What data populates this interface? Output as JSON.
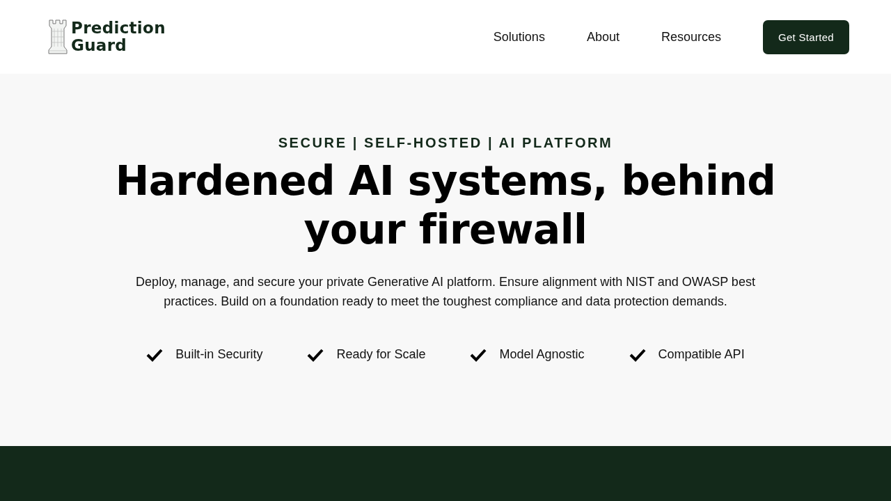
{
  "header": {
    "logo": {
      "line_1": "Prediction",
      "line_2": "Guard"
    },
    "nav": [
      "Solutions",
      "About",
      "Resources"
    ],
    "cta": "Get Started"
  },
  "hero": {
    "eyebrow": "SECURE | SELF-HOSTED | AI PLATFORM",
    "title": "Hardened AI systems, behind your firewall",
    "description": "Deploy, manage, and secure your private Generative AI platform. Ensure alignment with NIST and OWASP best practices. Build on a foundation ready to meet the toughest compliance and data protection demands.",
    "features": [
      "Built-in Security",
      "Ready for Scale",
      "Model Agnostic",
      "Compatible API"
    ]
  }
}
